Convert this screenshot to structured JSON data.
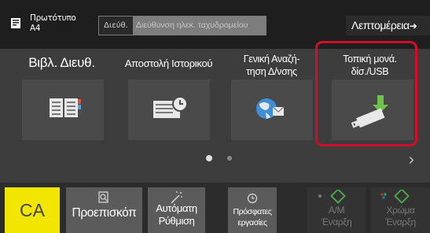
{
  "header": {
    "original_label": "Πρωτότυπο",
    "original_size": "A4",
    "address_tag": "Διεύθ.",
    "address_placeholder": "Διεύθυνση ηλεκ. ταχυδρομείου",
    "details_label": "Λεπτομέρεια",
    "details_arrow": "➜"
  },
  "tiles": [
    {
      "label": "Βιβλ. Διευθ.",
      "icon": "address-book-icon"
    },
    {
      "label": "Αποστολή Ιστορικού",
      "icon": "send-history-icon"
    },
    {
      "label_line1": "Γενική Αναζή-",
      "label_line2": "τηση Δ/νσης",
      "icon": "global-address-search-icon"
    },
    {
      "label_line1": "Τοπική μονά.",
      "label_line2": "δίσ./USB",
      "icon": "usb-drive-icon",
      "highlighted": true
    }
  ],
  "pager": {
    "page_count": 2,
    "current_page": 1,
    "next": "›"
  },
  "bottom": {
    "ca": "CA",
    "preview": "Προεπισκόπ",
    "auto_line1": "Αυτόματη",
    "auto_line2": "Ρύθμιση",
    "recent_line1": "Πρόσφατες",
    "recent_line2": "εργασίες",
    "bw_line1": "Α/Μ",
    "bw_line2": "Έναρξη",
    "color_line1": "Χρώμα",
    "color_line2": "Έναρξη"
  },
  "colors": {
    "ca": "#f2e500",
    "highlight": "#d0102a",
    "start_diamond": "#4caf50"
  }
}
